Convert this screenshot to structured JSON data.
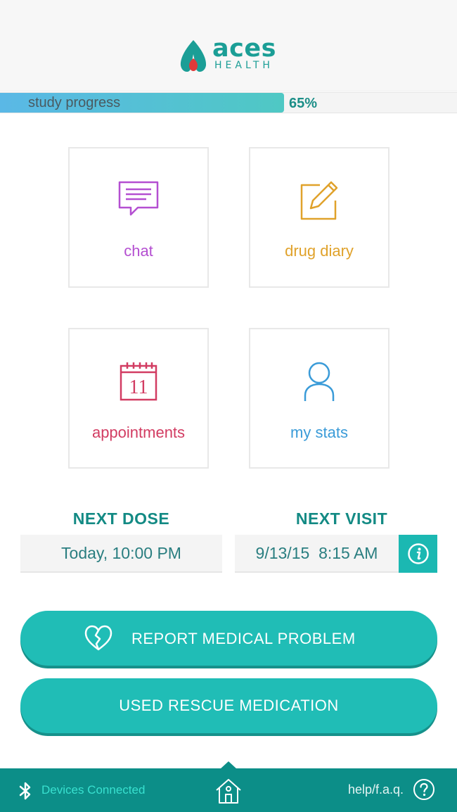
{
  "header": {
    "logo_word": "aces",
    "logo_sub": "HEALTH"
  },
  "progress": {
    "label": "study progress",
    "percent_text": "65%",
    "fraction": 0.65
  },
  "tiles": [
    {
      "label": "chat",
      "icon": "chat-bubble-icon",
      "color": "#b44fd1"
    },
    {
      "label": "drug diary",
      "icon": "edit-note-icon",
      "color": "#e0a22b"
    },
    {
      "label": "appointments",
      "icon": "calendar-icon",
      "color": "#d23c62",
      "calendar_day": "11"
    },
    {
      "label": "my stats",
      "icon": "person-icon",
      "color": "#3a9bd8"
    }
  ],
  "schedule": {
    "next_dose_title": "NEXT DOSE",
    "next_dose_value": "Today, 10:00 PM",
    "next_visit_title": "NEXT VISIT",
    "next_visit_value": "9/13/15  8:15 AM",
    "info_icon": "info-icon"
  },
  "actions": {
    "report_label": "REPORT MEDICAL PROBLEM",
    "report_icon": "broken-heart-icon",
    "rescue_label": "USED RESCUE MEDICATION"
  },
  "footer": {
    "devices_label": "Devices Connected",
    "bluetooth_icon": "bluetooth-icon",
    "home_icon": "home-icon",
    "help_label": "help/f.a.q.",
    "help_icon": "question-icon"
  },
  "colors": {
    "brand": "#1b9e96",
    "accent": "#20bdb6",
    "footer": "#0c8e88",
    "logo_red": "#e03a3a"
  }
}
